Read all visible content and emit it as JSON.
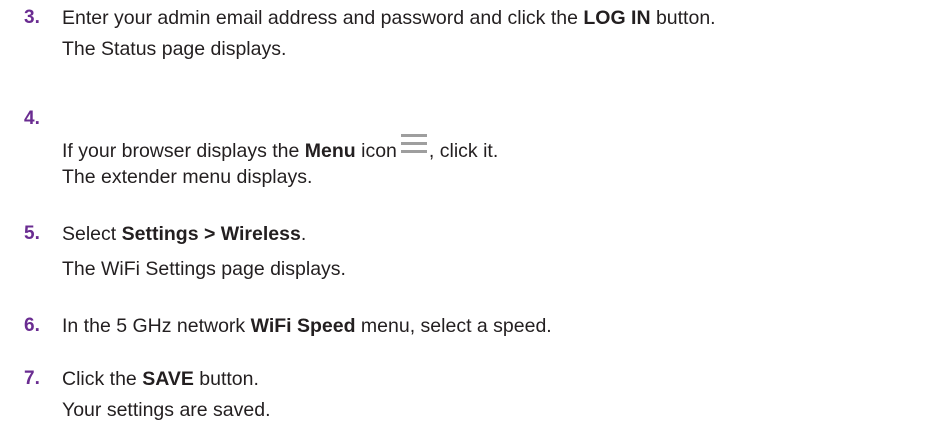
{
  "steps": [
    {
      "number": "3.",
      "line1": {
        "pre": "Enter your admin email address and password and click the ",
        "bold": "LOG IN",
        "post": " button."
      },
      "line2": "The Status page displays."
    },
    {
      "number": "4.",
      "line1": {
        "pre": "If your browser displays the ",
        "bold": "Menu",
        "mid": " icon",
        "icon": "hamburger-menu-icon",
        "post": ", click it."
      },
      "line2": "The extender menu displays."
    },
    {
      "number": "5.",
      "line1": {
        "pre": "Select ",
        "bold": "Settings > Wireless",
        "post": "."
      },
      "line2": "The WiFi Settings page displays."
    },
    {
      "number": "6.",
      "line1": {
        "pre": "In the 5 GHz network ",
        "bold": "WiFi Speed",
        "post": " menu, select a speed."
      }
    },
    {
      "number": "7.",
      "line1": {
        "pre": "Click the ",
        "bold": "SAVE",
        "post": " button."
      },
      "line2": "Your settings are saved."
    }
  ],
  "colors": {
    "step_number": "#6a2c91",
    "body_text": "#231f20",
    "menu_icon": "#9e9e9e"
  }
}
